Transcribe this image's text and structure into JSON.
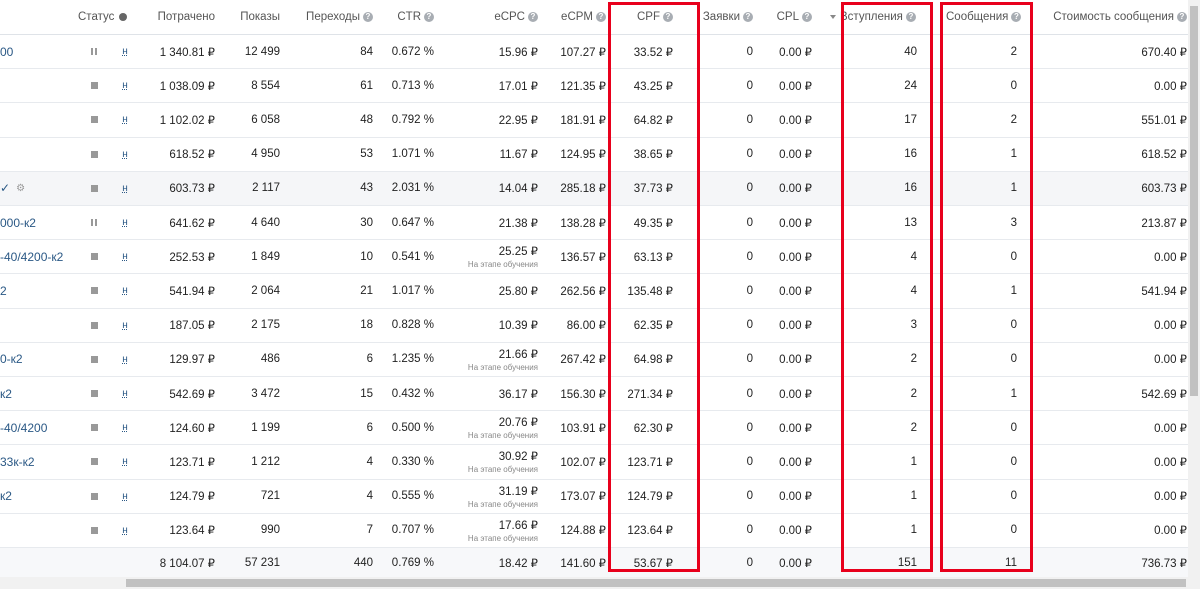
{
  "headers": {
    "status": "Статус",
    "spent": "Потрачено",
    "impressions": "Показы",
    "clicks": "Переходы",
    "ctr": "CTR",
    "ecpc": "eCPC",
    "ecpm": "eCPM",
    "cpf": "CPF",
    "requests": "Заявки",
    "cpl": "CPL",
    "joins": "Вступления",
    "messages": "Сообщения",
    "msg_cost": "Стоимость сообщения"
  },
  "learning_note": "На этапе обучения",
  "rows": [
    {
      "name": "00",
      "status": "pause",
      "link": "н",
      "spent": "1 340.81 ₽",
      "impressions": "12 499",
      "clicks": "84",
      "ctr": "0.672 %",
      "ecpc": "15.96 ₽",
      "ecpc_note": "",
      "ecpm": "107.27 ₽",
      "cpf": "33.52 ₽",
      "requests": "0",
      "cpl": "0.00 ₽",
      "joins": "40",
      "messages": "2",
      "msg_cost": "670.40 ₽"
    },
    {
      "name": "",
      "status": "stop",
      "link": "н",
      "spent": "1 038.09 ₽",
      "impressions": "8 554",
      "clicks": "61",
      "ctr": "0.713 %",
      "ecpc": "17.01 ₽",
      "ecpc_note": "",
      "ecpm": "121.35 ₽",
      "cpf": "43.25 ₽",
      "requests": "0",
      "cpl": "0.00 ₽",
      "joins": "24",
      "messages": "0",
      "msg_cost": "0.00 ₽"
    },
    {
      "name": "",
      "status": "stop",
      "link": "н",
      "spent": "1 102.02 ₽",
      "impressions": "6 058",
      "clicks": "48",
      "ctr": "0.792 %",
      "ecpc": "22.95 ₽",
      "ecpc_note": "",
      "ecpm": "181.91 ₽",
      "cpf": "64.82 ₽",
      "requests": "0",
      "cpl": "0.00 ₽",
      "joins": "17",
      "messages": "2",
      "msg_cost": "551.01 ₽"
    },
    {
      "name": "",
      "status": "stop",
      "link": "н",
      "spent": "618.52 ₽",
      "impressions": "4 950",
      "clicks": "53",
      "ctr": "1.071 %",
      "ecpc": "11.67 ₽",
      "ecpc_note": "",
      "ecpm": "124.95 ₽",
      "cpf": "38.65 ₽",
      "requests": "0",
      "cpl": "0.00 ₽",
      "joins": "16",
      "messages": "1",
      "msg_cost": "618.52 ₽"
    },
    {
      "name": "✓",
      "status": "stop",
      "link": "н",
      "spent": "603.73 ₽",
      "impressions": "2 117",
      "clicks": "43",
      "ctr": "2.031 %",
      "ecpc": "14.04 ₽",
      "ecpc_note": "",
      "ecpm": "285.18 ₽",
      "cpf": "37.73 ₽",
      "requests": "0",
      "cpl": "0.00 ₽",
      "joins": "16",
      "messages": "1",
      "msg_cost": "603.73 ₽",
      "gear": "⚙"
    },
    {
      "name": "000-к2",
      "status": "pause",
      "link": "н",
      "spent": "641.62 ₽",
      "impressions": "4 640",
      "clicks": "30",
      "ctr": "0.647 %",
      "ecpc": "21.38 ₽",
      "ecpc_note": "",
      "ecpm": "138.28 ₽",
      "cpf": "49.35 ₽",
      "requests": "0",
      "cpl": "0.00 ₽",
      "joins": "13",
      "messages": "3",
      "msg_cost": "213.87 ₽"
    },
    {
      "name": "-40/4200-к2",
      "status": "stop",
      "link": "н",
      "spent": "252.53 ₽",
      "impressions": "1 849",
      "clicks": "10",
      "ctr": "0.541 %",
      "ecpc": "25.25 ₽",
      "ecpc_note": "На этапе обучения",
      "ecpm": "136.57 ₽",
      "cpf": "63.13 ₽",
      "requests": "0",
      "cpl": "0.00 ₽",
      "joins": "4",
      "messages": "0",
      "msg_cost": "0.00 ₽"
    },
    {
      "name": "2",
      "status": "stop",
      "link": "н",
      "spent": "541.94 ₽",
      "impressions": "2 064",
      "clicks": "21",
      "ctr": "1.017 %",
      "ecpc": "25.80 ₽",
      "ecpc_note": "",
      "ecpm": "262.56 ₽",
      "cpf": "135.48 ₽",
      "requests": "0",
      "cpl": "0.00 ₽",
      "joins": "4",
      "messages": "1",
      "msg_cost": "541.94 ₽"
    },
    {
      "name": "",
      "status": "stop",
      "link": "н",
      "spent": "187.05 ₽",
      "impressions": "2 175",
      "clicks": "18",
      "ctr": "0.828 %",
      "ecpc": "10.39 ₽",
      "ecpc_note": "",
      "ecpm": "86.00 ₽",
      "cpf": "62.35 ₽",
      "requests": "0",
      "cpl": "0.00 ₽",
      "joins": "3",
      "messages": "0",
      "msg_cost": "0.00 ₽"
    },
    {
      "name": "0-к2",
      "status": "stop",
      "link": "н",
      "spent": "129.97 ₽",
      "impressions": "486",
      "clicks": "6",
      "ctr": "1.235 %",
      "ecpc": "21.66 ₽",
      "ecpc_note": "На этапе обучения",
      "ecpm": "267.42 ₽",
      "cpf": "64.98 ₽",
      "requests": "0",
      "cpl": "0.00 ₽",
      "joins": "2",
      "messages": "0",
      "msg_cost": "0.00 ₽"
    },
    {
      "name": "к2",
      "status": "stop",
      "link": "н",
      "spent": "542.69 ₽",
      "impressions": "3 472",
      "clicks": "15",
      "ctr": "0.432 %",
      "ecpc": "36.17 ₽",
      "ecpc_note": "",
      "ecpm": "156.30 ₽",
      "cpf": "271.34 ₽",
      "requests": "0",
      "cpl": "0.00 ₽",
      "joins": "2",
      "messages": "1",
      "msg_cost": "542.69 ₽"
    },
    {
      "name": "-40/4200",
      "status": "stop",
      "link": "н",
      "spent": "124.60 ₽",
      "impressions": "1 199",
      "clicks": "6",
      "ctr": "0.500 %",
      "ecpc": "20.76 ₽",
      "ecpc_note": "На этапе обучения",
      "ecpm": "103.91 ₽",
      "cpf": "62.30 ₽",
      "requests": "0",
      "cpl": "0.00 ₽",
      "joins": "2",
      "messages": "0",
      "msg_cost": "0.00 ₽"
    },
    {
      "name": "33к-к2",
      "status": "stop",
      "link": "н",
      "spent": "123.71 ₽",
      "impressions": "1 212",
      "clicks": "4",
      "ctr": "0.330 %",
      "ecpc": "30.92 ₽",
      "ecpc_note": "На этапе обучения",
      "ecpm": "102.07 ₽",
      "cpf": "123.71 ₽",
      "requests": "0",
      "cpl": "0.00 ₽",
      "joins": "1",
      "messages": "0",
      "msg_cost": "0.00 ₽"
    },
    {
      "name": "к2",
      "status": "stop",
      "link": "н",
      "spent": "124.79 ₽",
      "impressions": "721",
      "clicks": "4",
      "ctr": "0.555 %",
      "ecpc": "31.19 ₽",
      "ecpc_note": "На этапе обучения",
      "ecpm": "173.07 ₽",
      "cpf": "124.79 ₽",
      "requests": "0",
      "cpl": "0.00 ₽",
      "joins": "1",
      "messages": "0",
      "msg_cost": "0.00 ₽"
    },
    {
      "name": "",
      "status": "stop",
      "link": "н",
      "spent": "123.64 ₽",
      "impressions": "990",
      "clicks": "7",
      "ctr": "0.707 %",
      "ecpc": "17.66 ₽",
      "ecpc_note": "На этапе обучения",
      "ecpm": "124.88 ₽",
      "cpf": "123.64 ₽",
      "requests": "0",
      "cpl": "0.00 ₽",
      "joins": "1",
      "messages": "0",
      "msg_cost": "0.00 ₽"
    }
  ],
  "total": {
    "spent": "8 104.07 ₽",
    "impressions": "57 231",
    "clicks": "440",
    "ctr": "0.769 %",
    "ecpc": "18.42 ₽",
    "ecpm": "141.60 ₽",
    "cpf": "53.67 ₽",
    "requests": "0",
    "cpl": "0.00 ₽",
    "joins": "151",
    "messages": "11",
    "msg_cost": "736.73 ₽"
  },
  "colors": {
    "highlight_box": "#e8001c",
    "link": "#2a5885",
    "alt_row": "#f5f6f8"
  }
}
